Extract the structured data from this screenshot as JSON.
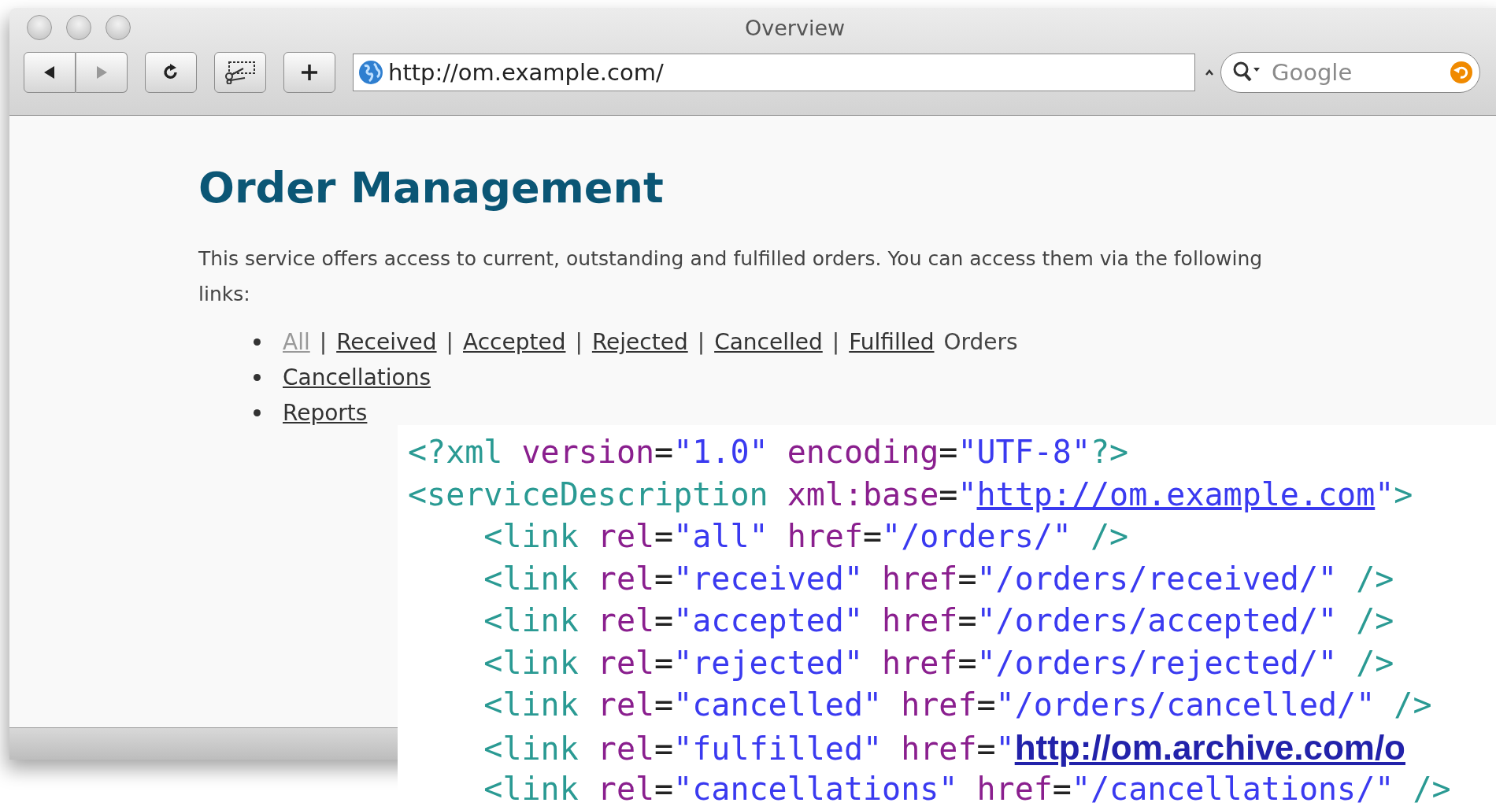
{
  "window": {
    "title": "Overview"
  },
  "toolbar": {
    "address": "http://om.example.com/",
    "search": {
      "placeholder": "Google"
    }
  },
  "page": {
    "heading": "Order Management",
    "intro": "This service offers access to current, outstanding and fulfilled orders. You can access them via the following links:",
    "list": [
      {
        "parts": [
          {
            "kind": "link",
            "text": "All",
            "visited": true
          },
          {
            "kind": "text",
            "text": "|"
          },
          {
            "kind": "link",
            "text": "Received",
            "visited": false
          },
          {
            "kind": "text",
            "text": "|"
          },
          {
            "kind": "link",
            "text": "Accepted",
            "visited": false
          },
          {
            "kind": "text",
            "text": "|"
          },
          {
            "kind": "link",
            "text": "Rejected",
            "visited": false
          },
          {
            "kind": "text",
            "text": "|"
          },
          {
            "kind": "link",
            "text": "Cancelled",
            "visited": false
          },
          {
            "kind": "text",
            "text": "|"
          },
          {
            "kind": "link",
            "text": "Fulfilled",
            "visited": false
          },
          {
            "kind": "text",
            "text": "Orders"
          }
        ]
      },
      {
        "parts": [
          {
            "kind": "link",
            "text": "Cancellations",
            "visited": false
          }
        ]
      },
      {
        "parts": [
          {
            "kind": "link",
            "text": "Reports",
            "visited": false
          }
        ]
      }
    ]
  },
  "code": {
    "lines": [
      {
        "tokens": [
          {
            "kind": "tag",
            "text": "<?xml"
          },
          {
            "kind": "attr",
            "text": " version"
          },
          {
            "kind": "eq",
            "text": "="
          },
          {
            "kind": "value",
            "text": "\"1.0\""
          },
          {
            "kind": "attr",
            "text": " encoding"
          },
          {
            "kind": "eq",
            "text": "="
          },
          {
            "kind": "value",
            "text": "\"UTF-8\""
          },
          {
            "kind": "tag",
            "text": "?>"
          }
        ]
      },
      {
        "tokens": [
          {
            "kind": "tag",
            "text": "<serviceDescription"
          },
          {
            "kind": "attr",
            "text": " xml:base"
          },
          {
            "kind": "eq",
            "text": "="
          },
          {
            "kind": "value",
            "text": "\""
          },
          {
            "kind": "link",
            "text": "http://om.example.com"
          },
          {
            "kind": "value",
            "text": "\""
          },
          {
            "kind": "tag",
            "text": ">"
          }
        ],
        "children": [
          {
            "tokens": [
              {
                "kind": "tag",
                "text": "<link"
              },
              {
                "kind": "attr",
                "text": " rel"
              },
              {
                "kind": "eq",
                "text": "="
              },
              {
                "kind": "value",
                "text": "\"all\""
              },
              {
                "kind": "attr",
                "text": " href"
              },
              {
                "kind": "eq",
                "text": "="
              },
              {
                "kind": "value",
                "text": "\"/orders/\""
              },
              {
                "kind": "tag",
                "text": " />"
              }
            ]
          },
          {
            "tokens": [
              {
                "kind": "tag",
                "text": "<link"
              },
              {
                "kind": "attr",
                "text": " rel"
              },
              {
                "kind": "eq",
                "text": "="
              },
              {
                "kind": "value",
                "text": "\"received\""
              },
              {
                "kind": "attr",
                "text": " href"
              },
              {
                "kind": "eq",
                "text": "="
              },
              {
                "kind": "value",
                "text": "\"/orders/received/\""
              },
              {
                "kind": "tag",
                "text": " />"
              }
            ]
          },
          {
            "tokens": [
              {
                "kind": "tag",
                "text": "<link"
              },
              {
                "kind": "attr",
                "text": " rel"
              },
              {
                "kind": "eq",
                "text": "="
              },
              {
                "kind": "value",
                "text": "\"accepted\""
              },
              {
                "kind": "attr",
                "text": " href"
              },
              {
                "kind": "eq",
                "text": "="
              },
              {
                "kind": "value",
                "text": "\"/orders/accepted/\""
              },
              {
                "kind": "tag",
                "text": " />"
              }
            ]
          },
          {
            "tokens": [
              {
                "kind": "tag",
                "text": "<link"
              },
              {
                "kind": "attr",
                "text": " rel"
              },
              {
                "kind": "eq",
                "text": "="
              },
              {
                "kind": "value",
                "text": "\"rejected\""
              },
              {
                "kind": "attr",
                "text": " href"
              },
              {
                "kind": "eq",
                "text": "="
              },
              {
                "kind": "value",
                "text": "\"/orders/rejected/\""
              },
              {
                "kind": "tag",
                "text": " />"
              }
            ]
          },
          {
            "tokens": [
              {
                "kind": "tag",
                "text": "<link"
              },
              {
                "kind": "attr",
                "text": " rel"
              },
              {
                "kind": "eq",
                "text": "="
              },
              {
                "kind": "value",
                "text": "\"cancelled\""
              },
              {
                "kind": "attr",
                "text": " href"
              },
              {
                "kind": "eq",
                "text": "="
              },
              {
                "kind": "value",
                "text": "\"/orders/cancelled/\""
              },
              {
                "kind": "tag",
                "text": " />"
              }
            ]
          },
          {
            "tokens": [
              {
                "kind": "tag",
                "text": "<link"
              },
              {
                "kind": "attr",
                "text": " rel"
              },
              {
                "kind": "eq",
                "text": "="
              },
              {
                "kind": "value",
                "text": "\"fulfilled\""
              },
              {
                "kind": "attr",
                "text": " href"
              },
              {
                "kind": "eq",
                "text": "="
              },
              {
                "kind": "value",
                "text": "\""
              },
              {
                "kind": "biglink",
                "text": "http://om.archive.com/o"
              }
            ]
          },
          {
            "tokens": [
              {
                "kind": "tag",
                "text": "<link"
              },
              {
                "kind": "attr",
                "text": " rel"
              },
              {
                "kind": "eq",
                "text": "="
              },
              {
                "kind": "value",
                "text": "\"cancellations\""
              },
              {
                "kind": "attr",
                "text": " href"
              },
              {
                "kind": "eq",
                "text": "="
              },
              {
                "kind": "value",
                "text": "\"/cancellations/\""
              },
              {
                "kind": "tag",
                "text": " />"
              }
            ]
          }
        ]
      }
    ]
  }
}
